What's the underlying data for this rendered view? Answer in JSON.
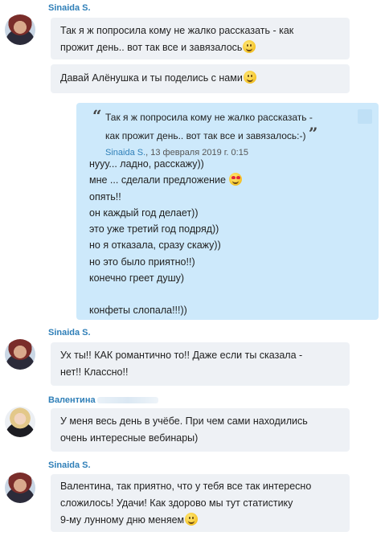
{
  "messages": [
    {
      "sender": "Sinaida S.",
      "bubbles": [
        {
          "lines": [
            "Так я ж попросила кому не жалко рассказать - как",
            "прожит день.. вот так все и завязалось"
          ],
          "emoji_end": "smile-emoji-icon"
        },
        {
          "lines": [
            "Давай Алёнушка и ты поделись с нами"
          ],
          "emoji_end": "smile-emoji-icon"
        }
      ]
    },
    {
      "sender": "",
      "quote": {
        "open_mark": "“",
        "close_mark": "”",
        "lines": [
          "Так я ж попросила кому не жалко рассказать -",
          "как прожит день.. вот так все и завязалось:-)"
        ],
        "author": "Sinaida S.",
        "date": ", 13 февраля 2019 г. 0:15"
      },
      "lines": [
        "нууу... ладно, расскажу))",
        "мне ... сделали предложение",
        "опять!!",
        "он каждый год делает))",
        "это уже третий год подряд))",
        "но я отказала, сразу скажу))",
        "но это было приятно!!)",
        "конечно греет душу)",
        "",
        "конфеты слопала!!!))"
      ]
    },
    {
      "sender": "Sinaida S.",
      "lines": [
        "Ух ты!! КАК романтично то!! Даже если ты сказала -",
        "нет!! Классно!!"
      ]
    },
    {
      "sender": "Валентина",
      "lines": [
        "У меня весь день в учёбе. При чем сами находились",
        "очень интересные вебинары)"
      ]
    },
    {
      "sender": "Sinaida S.",
      "lines": [
        "Валентина, так приятно, что у тебя все так интересно",
        "сложилось! Удачи! Как здорово мы тут статистику",
        "9-му лунному дню меняем"
      ],
      "emoji_end": "smile-emoji-icon"
    }
  ]
}
